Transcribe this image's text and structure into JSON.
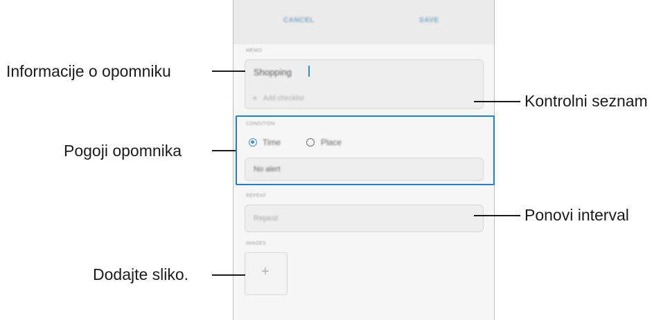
{
  "toolbar": {
    "cancel_label": "CANCEL",
    "save_label": "SAVE"
  },
  "reminder": {
    "section_label": "MEMO",
    "text_value": "Shopping",
    "checklist_placeholder": "Add checklist",
    "checklist_plus": "+"
  },
  "condition": {
    "section_label": "CONDITION",
    "options": [
      {
        "label": "Time",
        "selected": true
      },
      {
        "label": "Place",
        "selected": false
      }
    ],
    "alert_value": "No alert"
  },
  "repeat": {
    "section_label": "REPEAT",
    "placeholder": "Repeat"
  },
  "images": {
    "section_label": "IMAGES",
    "add_symbol": "+"
  },
  "callouts": {
    "reminder_info": "Informacije o opomniku",
    "checklist": "Kontrolni seznam",
    "conditions": "Pogoji opomnika",
    "repeat_interval": "Ponovi interval",
    "add_image": "Dodajte sliko."
  },
  "colors": {
    "accent": "#1e7ec8",
    "callout_text": "#1a1a1a",
    "topbar": "#ebebeb"
  }
}
